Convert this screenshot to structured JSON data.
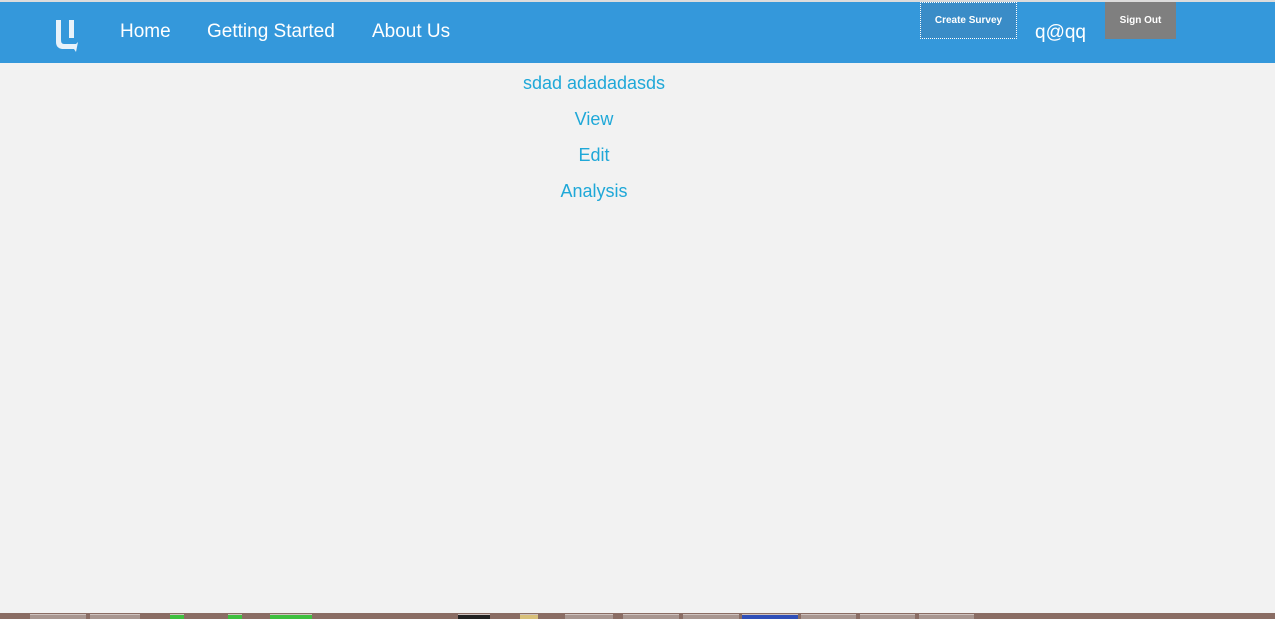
{
  "navbar": {
    "logo_letter": "U",
    "links": [
      "Home",
      "Getting Started",
      "About Us"
    ],
    "create_survey_label": "Create Survey",
    "user_email": "q@qq",
    "sign_out_label": "Sign Out",
    "bg_color": "#3498db"
  },
  "survey": {
    "title": "sdad adadadasds",
    "actions": [
      "View",
      "Edit",
      "Analysis"
    ],
    "link_color": "#1fa8d8"
  },
  "taskbar": {
    "icons": [
      "taskbar-app-icon",
      "taskbar-app-icon",
      "taskbar-app-icon",
      "taskbar-app-icon",
      "taskbar-app-icon",
      "taskbar-app-icon",
      "taskbar-app-icon",
      "taskbar-app-icon",
      "taskbar-app-icon",
      "taskbar-app-icon",
      "taskbar-app-icon",
      "taskbar-app-icon",
      "taskbar-app-icon",
      "taskbar-app-icon"
    ]
  }
}
